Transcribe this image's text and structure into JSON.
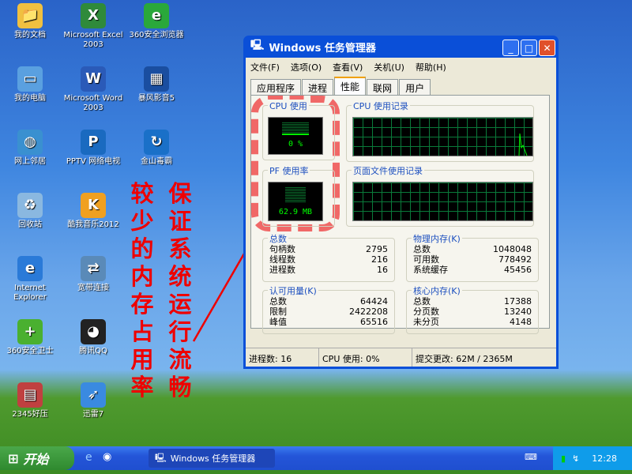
{
  "desktop": {
    "icons": [
      {
        "label": "我的文档",
        "color": "#f0c040",
        "glyph": "📁"
      },
      {
        "label": "Microsoft Excel 2003",
        "color": "#2f8a3a",
        "glyph": "X"
      },
      {
        "label": "360安全浏览器",
        "color": "#2aa83a",
        "glyph": "e"
      },
      {
        "label": "我的电脑",
        "color": "#5aa0e0",
        "glyph": "▭"
      },
      {
        "label": "Microsoft Word 2003",
        "color": "#2a5ab8",
        "glyph": "W"
      },
      {
        "label": "暴风影音5",
        "color": "#1a4ea0",
        "glyph": "▦"
      },
      {
        "label": "网上邻居",
        "color": "#3a90d0",
        "glyph": "◍"
      },
      {
        "label": "PPTV 网络电视",
        "color": "#1a6ac0",
        "glyph": "P"
      },
      {
        "label": "金山毒霸",
        "color": "#1a70c8",
        "glyph": "↻"
      },
      {
        "label": "回收站",
        "color": "#8ab8e0",
        "glyph": "♻"
      },
      {
        "label": "酷我音乐2012",
        "color": "#f0a020",
        "glyph": "K"
      },
      {
        "label": "Internet Explorer",
        "color": "#2a7ad8",
        "glyph": "e"
      },
      {
        "label": "宽带连接",
        "color": "#5a8ab8",
        "glyph": "⇄"
      },
      {
        "label": "360安全卫士",
        "color": "#4ab030",
        "glyph": "+"
      },
      {
        "label": "腾讯QQ",
        "color": "#222",
        "glyph": "◕"
      },
      {
        "label": "2345好压",
        "color": "#c04040",
        "glyph": "▤"
      },
      {
        "label": "迅雷7",
        "color": "#3a8ae0",
        "glyph": "➶"
      }
    ]
  },
  "annotation": {
    "col1": "较少的内存占用率",
    "col2": "保证系统运行流畅",
    "color": "#e00000"
  },
  "window": {
    "title": "Windows 任务管理器",
    "menu": [
      "文件(F)",
      "选项(O)",
      "查看(V)",
      "关机(U)",
      "帮助(H)"
    ],
    "tabs": [
      "应用程序",
      "进程",
      "性能",
      "联网",
      "用户"
    ],
    "active_tab": "性能",
    "cpu_usage": {
      "label": "CPU 使用",
      "value": "0 %"
    },
    "cpu_history": {
      "label": "CPU 使用记录"
    },
    "pf_usage": {
      "label": "PF 使用率",
      "value": "62.9 MB"
    },
    "pf_history": {
      "label": "页面文件使用记录"
    },
    "totals": {
      "label": "总数",
      "rows": [
        [
          "句柄数",
          "2795"
        ],
        [
          "线程数",
          "216"
        ],
        [
          "进程数",
          "16"
        ]
      ]
    },
    "physical": {
      "label": "物理内存(K)",
      "rows": [
        [
          "总数",
          "1048048"
        ],
        [
          "可用数",
          "778492"
        ],
        [
          "系统缓存",
          "45456"
        ]
      ]
    },
    "commit": {
      "label": "认可用量(K)",
      "rows": [
        [
          "总数",
          "64424"
        ],
        [
          "限制",
          "2422208"
        ],
        [
          "峰值",
          "65516"
        ]
      ]
    },
    "kernel": {
      "label": "核心内存(K)",
      "rows": [
        [
          "总数",
          "17388"
        ],
        [
          "分页数",
          "13240"
        ],
        [
          "未分页",
          "4148"
        ]
      ]
    },
    "status": {
      "processes": "进程数: 16",
      "cpu": "CPU 使用: 0%",
      "commit": "提交更改: 62M / 2365M"
    }
  },
  "taskbar": {
    "start": "开始",
    "task": "Windows 任务管理器",
    "clock": "12:28"
  }
}
